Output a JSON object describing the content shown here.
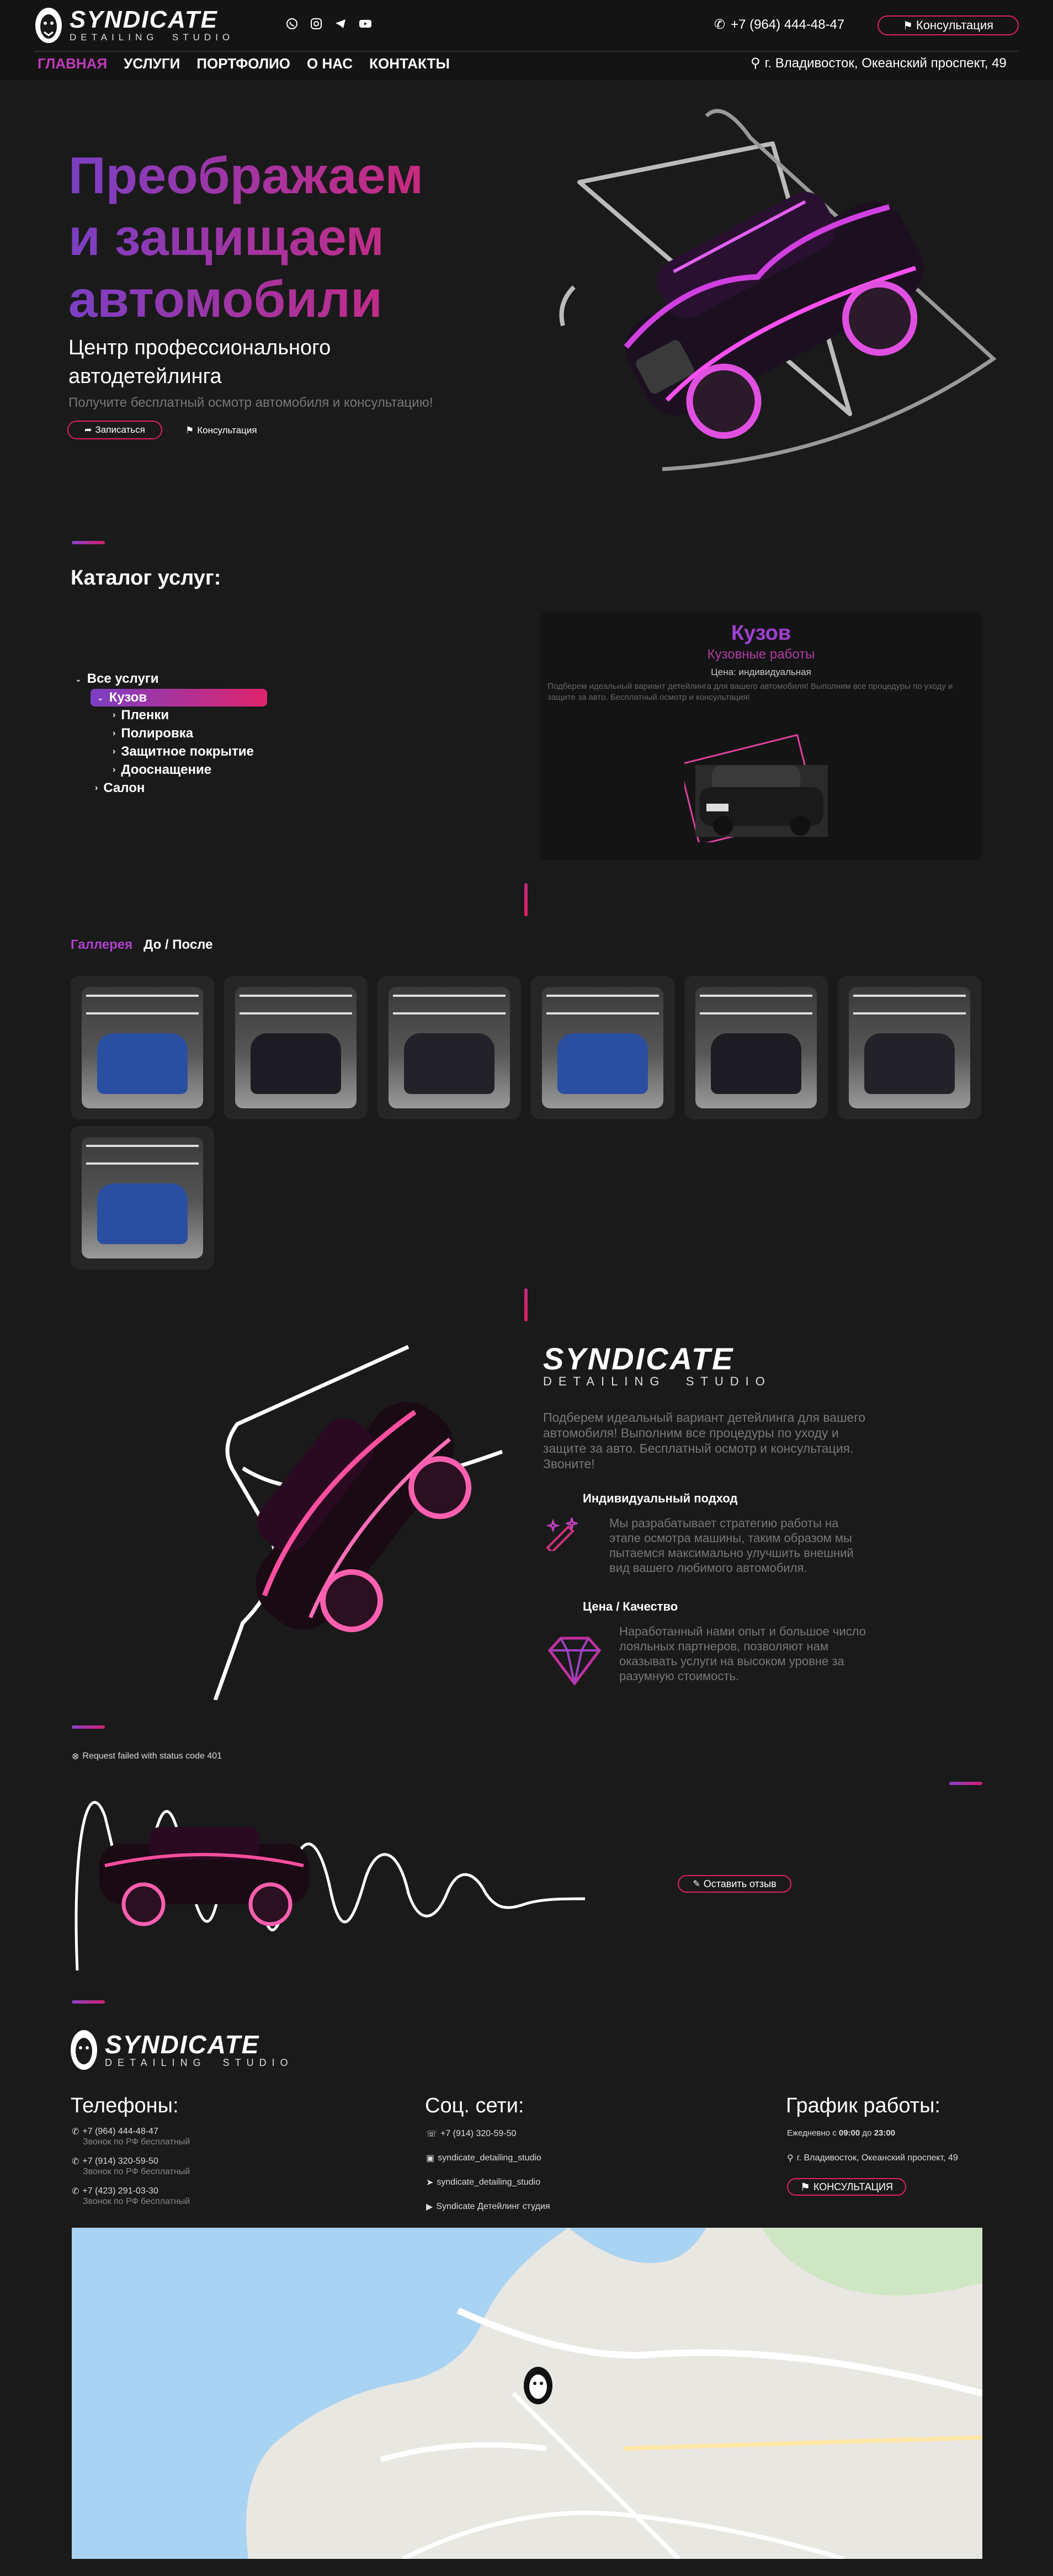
{
  "header": {
    "brand": "SYNDICATE",
    "brand_sub": "DETAILING  STUDIO",
    "phone": "+7 (964) 444-48-47",
    "consult_label": "Консультация",
    "nav": [
      "ГЛАВНАЯ",
      "УСЛУГИ",
      "ПОРТФОЛИО",
      "О НАС",
      "КОНТАКТЫ"
    ],
    "address": "г. Владивосток, Океанский проспект, 49"
  },
  "hero": {
    "title_lines": [
      "Преображаем",
      "и защищаем",
      "автомобили"
    ],
    "subtitle_lines": [
      "Центр профессионального",
      "автодетейлинга"
    ],
    "note": "Получите бесплатный осмотр автомобиля и консультацию!",
    "signup_label": "Записаться",
    "consult_label": "Консультация"
  },
  "catalog": {
    "heading": "Каталог услуг:",
    "tree": {
      "all": "Все услуги",
      "body": "Кузов",
      "films": "Пленки",
      "polish": "Полировка",
      "coating": "Защитное покрытие",
      "extras": "Дооснащение",
      "salon": "Салон"
    },
    "card": {
      "title": "Кузов",
      "subtitle": "Кузовные работы",
      "price": "Цена: индивидуальная",
      "description": "Подберем идеальный вариант детейлинга для вашего автомобиля! Выполним все процедуры по уходу и защите за авто. Бесплатный осмотр и консультация!"
    }
  },
  "gallery": {
    "tab_active": "Галлерея",
    "tab_other": "До / После",
    "items": [
      {
        "name": "blue-bmw",
        "color": "#2a4fa0"
      },
      {
        "name": "black-lexus",
        "color": "#1c1c22"
      },
      {
        "name": "black-suv",
        "color": "#222228"
      },
      {
        "name": "blue-bmw",
        "color": "#2a4fa0"
      },
      {
        "name": "black-lexus",
        "color": "#1c1c22"
      },
      {
        "name": "black-suv",
        "color": "#222228"
      },
      {
        "name": "blue-bmw",
        "color": "#2a4fa0"
      }
    ]
  },
  "about": {
    "brand": "SYNDICATE",
    "brand_sub": "DETAILING  STUDIO",
    "intro": "Подберем идеальный вариант детейлинга для вашего автомобиля! Выполним все процедуры по уходу и защите за авто. Бесплатный осмотр и консультация. Звоните!",
    "feature1_title": "Индивидуальный подход",
    "feature1_text": "Мы разрабатывает стратегию работы на этапе осмотра машины, таким образом мы пытаемся максимально улучшить внешний вид вашего любимого автомобиля.",
    "feature2_title": "Цена / Качество",
    "feature2_text": "Наработанный нами опыт и большое число лояльных партнеров, позволяют нам оказывать услуги на высоком уровне за разумную стоимость."
  },
  "reviews": {
    "error": "Request failed with status code 401",
    "leave_review": "Оставить отзыв"
  },
  "footer": {
    "brand": "SYNDICATE",
    "brand_sub": "DETAILING  STUDIO",
    "phones_title": "Телефоны:",
    "phones": [
      {
        "number": "+7 (964) 444-48-47",
        "note": "Звонок по РФ бесплатный"
      },
      {
        "number": "+7 (914) 320-59-50",
        "note": "Звонок по РФ бесплатный"
      },
      {
        "number": "+7 (423) 291-03-30",
        "note": "Звонок по РФ бесплатный"
      }
    ],
    "social_title": "Соц. сети:",
    "social": [
      {
        "icon": "whatsapp-icon",
        "text": "+7 (914) 320-59-50"
      },
      {
        "icon": "instagram-icon",
        "text": "syndicate_detailing_studio"
      },
      {
        "icon": "telegram-icon",
        "text": "syndicate_detailing_studio"
      },
      {
        "icon": "youtube-icon",
        "text": "Syndicate Детейлинг студия"
      }
    ],
    "schedule_title": "График работы:",
    "schedule_prefix": "Ежедневно с ",
    "schedule_from": "09:00",
    "schedule_mid": " до ",
    "schedule_to": "23:00",
    "address": "г. Владивосток, Океанский проспект, 49",
    "consult_label": "КОНСУЛЬТАЦИЯ"
  },
  "colors": {
    "accent_purple": "#8a3fc8",
    "accent_pink": "#e02060",
    "bg": "#1a1a1a"
  }
}
